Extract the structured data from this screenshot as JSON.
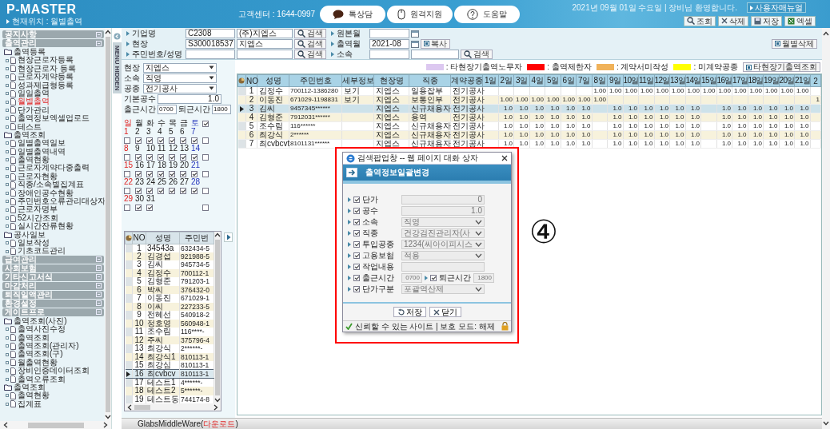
{
  "header": {
    "logo": "P-MASTER",
    "location": "현재위치 : 월별출역",
    "support": "고객센터 : 1644-0997",
    "buttons": [
      "톡상담",
      "원격지원",
      "도움말"
    ],
    "greeting": "2021년 09월 01일 수요일 | 장비님 환영합니다.",
    "manual_button": "사용자매뉴얼",
    "toolbar": [
      "조회",
      "삭제",
      "저장",
      "엑셀"
    ]
  },
  "sidebar": {
    "sections": [
      {
        "title": "공지사항"
      },
      {
        "title": "출역관리",
        "folders": [
          {
            "label": "출역등록",
            "items": [
              {
                "label": "현장근로자등록",
                "selected": false
              },
              {
                "label": "현장근로자 등록",
                "selected": false
              },
              {
                "label": "근로자계약등록",
                "selected": false
              },
              {
                "label": "성과제급형등록",
                "selected": false
              },
              {
                "label": "일일출역",
                "selected": false
              },
              {
                "label": "월별출역",
                "selected": true
              },
              {
                "label": "단가관리",
                "selected": false
              },
              {
                "label": "출역정보엑셀업로드",
                "selected": false
              },
              {
                "label": "테스트",
                "selected": false
              }
            ]
          },
          {
            "label": "출역조회",
            "items": [
              {
                "label": "일별출역일보",
                "selected": false
              },
              {
                "label": "일별출역내역",
                "selected": false
              },
              {
                "label": "출역현황",
                "selected": false
              },
              {
                "label": "근로자계약다중출력",
                "selected": false
              },
              {
                "label": "근로자현황",
                "selected": false
              },
              {
                "label": "직종/소속별집계표",
                "selected": false
              },
              {
                "label": "장애인공수현황",
                "selected": false
              },
              {
                "label": "주민번호오류관리대상자",
                "selected": false
              },
              {
                "label": "근로자명부",
                "selected": false
              },
              {
                "label": "52시간조회",
                "selected": false
              },
              {
                "label": "실시간잔류현황",
                "selected": false
              }
            ]
          },
          {
            "label": "공사일보",
            "items": [
              {
                "label": "일보작성",
                "selected": false
              },
              {
                "label": "기초코드관리",
                "selected": false
              }
            ]
          }
        ]
      },
      {
        "title": "급여관리"
      },
      {
        "title": "사회보험"
      },
      {
        "title": "기타신고서식"
      },
      {
        "title": "마감처리"
      },
      {
        "title": "퇴직일액관리"
      },
      {
        "title": "환경설정"
      },
      {
        "title": "게이트프로",
        "folders": [
          {
            "label": "출역조회(사진)",
            "items": [
              {
                "label": "출역사진수정",
                "selected": false
              },
              {
                "label": "출역조회",
                "selected": false
              },
              {
                "label": "출역조회(관리자)",
                "selected": false
              },
              {
                "label": "출역조회(구)",
                "selected": false
              },
              {
                "label": "월출역현황",
                "selected": false
              },
              {
                "label": "장비인증데이터조회",
                "selected": false
              },
              {
                "label": "출역오류조회",
                "selected": false
              }
            ]
          },
          {
            "label": "출역조회",
            "items": [
              {
                "label": "출역현황",
                "selected": false
              },
              {
                "label": "집계표",
                "selected": false
              }
            ]
          }
        ]
      }
    ]
  },
  "menu_tab": "MENU HIDDEN",
  "search_form": {
    "left": [
      {
        "label": "기업명",
        "code": "C2308",
        "name": "(주)지엡스",
        "button": "검색"
      },
      {
        "label": "현장",
        "code": "S300018537",
        "name": "지엡스",
        "button": "검색"
      },
      {
        "label": "주민번호/성명",
        "button": "검색"
      }
    ],
    "right": [
      {
        "label": "원본월",
        "kind": "month"
      },
      {
        "label": "출역월",
        "kind": "month",
        "value": "2021-08",
        "button": "복사"
      },
      {
        "label": "소속",
        "kind": "search",
        "button": "검색"
      }
    ],
    "delete_button": "월별삭제"
  },
  "legend": [
    {
      "label": ": 타현장기출역노무자",
      "color": "#dcc8f0"
    },
    {
      "label": ": 출역제한자",
      "color": "#ff0000"
    },
    {
      "label": ": 계약서미작성",
      "color": "#f0b25a"
    },
    {
      "label": ": 미계약공종",
      "color": "#ffff00"
    }
  ],
  "legend_button": "타현장기출역조회",
  "filters": {
    "selects": [
      {
        "label": "현장",
        "value": "지엡스"
      },
      {
        "label": "소속",
        "value": "직영"
      },
      {
        "label": "공종",
        "value": "전기공사"
      }
    ],
    "base_label": "기본공수",
    "base_value": "1.0",
    "start_label": "출근시간",
    "start_value": "0700",
    "end_label": "퇴근시간",
    "end_value": "1800"
  },
  "calendar": {
    "weekdays": [
      "일",
      "월",
      "화",
      "수",
      "목",
      "금",
      "토"
    ],
    "all_checked": true,
    "weeks": [
      {
        "row_checked": false,
        "days": [
          {
            "day": "1",
            "checked": false
          },
          {
            "day": "2",
            "checked": true
          },
          {
            "day": "3",
            "checked": true
          },
          {
            "day": "4",
            "checked": true
          },
          {
            "day": "5",
            "checked": true
          },
          {
            "day": "6",
            "checked": true
          },
          {
            "day": "7",
            "checked": true
          }
        ]
      },
      {
        "row_checked": false,
        "days": [
          {
            "day": "8",
            "checked": false
          },
          {
            "day": "9",
            "checked": true
          },
          {
            "day": "10",
            "checked": true
          },
          {
            "day": "11",
            "checked": true
          },
          {
            "day": "12",
            "checked": true
          },
          {
            "day": "13",
            "checked": true
          },
          {
            "day": "14",
            "checked": true
          }
        ]
      },
      {
        "row_checked": false,
        "days": [
          {
            "day": "15",
            "checked": false
          },
          {
            "day": "16",
            "checked": true
          },
          {
            "day": "17",
            "checked": true
          },
          {
            "day": "18",
            "checked": true
          },
          {
            "day": "19",
            "checked": true
          },
          {
            "day": "20",
            "checked": true
          },
          {
            "day": "21",
            "checked": true
          }
        ]
      },
      {
        "row_checked": false,
        "days": [
          {
            "day": "22",
            "checked": false
          },
          {
            "day": "23",
            "checked": true
          },
          {
            "day": "24",
            "checked": true
          },
          {
            "day": "25",
            "checked": true
          },
          {
            "day": "26",
            "checked": true
          },
          {
            "day": "27",
            "checked": true
          },
          {
            "day": "28",
            "checked": true
          }
        ]
      },
      {
        "row_checked": false,
        "days": [
          {
            "day": "29",
            "checked": false
          },
          {
            "day": "30",
            "checked": true
          },
          {
            "day": "31",
            "checked": true
          }
        ]
      }
    ]
  },
  "worker_list": {
    "columns": [
      "NO",
      "성명",
      "주민번"
    ],
    "rows": [
      {
        "no": "1",
        "name": "34543a",
        "id": "632434-5",
        "selected": false
      },
      {
        "no": "2",
        "name": "김경섭",
        "id": "921988-5",
        "selected": false
      },
      {
        "no": "3",
        "name": "김씨",
        "id": "945734-5",
        "selected": false
      },
      {
        "no": "4",
        "name": "김정수",
        "id": "700112-1",
        "selected": false
      },
      {
        "no": "5",
        "name": "김형준",
        "id": "791203-1",
        "selected": false
      },
      {
        "no": "6",
        "name": "박씨",
        "id": "376432-0",
        "selected": false
      },
      {
        "no": "7",
        "name": "이동진",
        "id": "671029-1",
        "selected": false
      },
      {
        "no": "8",
        "name": "이씨",
        "id": "227233-5",
        "selected": false
      },
      {
        "no": "9",
        "name": "전혜선",
        "id": "540918-2",
        "selected": false
      },
      {
        "no": "10",
        "name": "정호영",
        "id": "560948-1",
        "selected": false
      },
      {
        "no": "11",
        "name": "조수림",
        "id": "116****-",
        "selected": false
      },
      {
        "no": "12",
        "name": "주씨",
        "id": "375796-4",
        "selected": false
      },
      {
        "no": "13",
        "name": "최강식",
        "id": "2******-",
        "selected": false
      },
      {
        "no": "14",
        "name": "최강식1",
        "id": "810113-1",
        "selected": false
      },
      {
        "no": "15",
        "name": "최강심",
        "id": "810113-1",
        "selected": false
      },
      {
        "no": "16",
        "name": "최cvbcv",
        "id": "810113-1",
        "selected": true
      },
      {
        "no": "17",
        "name": "테스트1",
        "id": "4******-",
        "selected": false
      },
      {
        "no": "18",
        "name": "테스트2",
        "id": "5******-",
        "selected": false
      },
      {
        "no": "19",
        "name": "테스트동",
        "id": "744174-8",
        "selected": false
      }
    ]
  },
  "grid": {
    "columns": [
      "NO",
      "성명",
      "주민번호",
      "세부정보",
      "현장명",
      "직종",
      "계약공종",
      "1일",
      "2일",
      "3일",
      "4일",
      "5일",
      "6일",
      "7일",
      "8일",
      "9일",
      "10일",
      "11일",
      "12일",
      "13일",
      "14일",
      "15일",
      "16일",
      "17일",
      "18일",
      "19일",
      "20일",
      "21일",
      "2"
    ],
    "rows": [
      {
        "selected": false,
        "cells": [
          "1",
          "김정수",
          "700112-1386280",
          "보기",
          "지엡스",
          "일용잡부",
          "전기공사",
          null,
          null,
          null,
          null,
          null,
          null,
          null,
          "1.00",
          "1.00",
          "1.00",
          "1.00",
          "1.00",
          "1.00",
          "1.00",
          "1.00",
          "1.00",
          "1.00",
          "1.00",
          "1.00",
          "1.00",
          "1.00",
          null
        ]
      },
      {
        "selected": false,
        "cells": [
          "2",
          "이동진",
          "671029-1198831",
          "보기",
          "지엡스",
          "보통인부",
          "전기공사",
          null,
          "1.00",
          "1.00",
          "1.00",
          "1.00",
          "1.00",
          "1.00",
          "1.00",
          null,
          null,
          null,
          null,
          null,
          null,
          null,
          null,
          null,
          null,
          null,
          null,
          null,
          "1"
        ]
      },
      {
        "selected": true,
        "cells": [
          "3",
          "김씨",
          "9457345******",
          null,
          "지엡스",
          "신규채용자",
          "전기공사",
          null,
          "1.0",
          "1.0",
          "1.0",
          "1.0",
          "1.0",
          "1.0",
          null,
          "1.0",
          "1.0",
          "1.0",
          "1.0",
          "1.0",
          "1.0",
          null,
          "1.0",
          "1.0",
          "1.0",
          "1.0",
          "1.0",
          "1.0",
          null
        ]
      },
      {
        "selected": false,
        "cells": [
          "4",
          "김형준",
          "7912031******",
          null,
          "지엡스",
          "용역",
          "전기공사",
          null,
          "1.0",
          "1.0",
          "1.0",
          "1.0",
          "1.0",
          "1.0",
          null,
          "1.0",
          "1.0",
          "1.0",
          "1.0",
          "1.0",
          "1.0",
          null,
          "1.0",
          "1.0",
          "1.0",
          "1.0",
          "1.0",
          "1.0",
          null
        ]
      },
      {
        "selected": false,
        "cells": [
          "5",
          "조수림",
          "116******",
          null,
          "지엡스",
          "신규채용자",
          "전기공사",
          null,
          "1.0",
          "1.0",
          "1.0",
          "1.0",
          "1.0",
          "1.0",
          null,
          "1.0",
          "1.0",
          "1.0",
          "1.0",
          "1.0",
          "1.0",
          null,
          "1.0",
          "1.0",
          "1.0",
          "1.0",
          "1.0",
          "1.0",
          null
        ]
      },
      {
        "selected": false,
        "cells": [
          "6",
          "최강식",
          "2******",
          null,
          "지엡스",
          "신규채용자",
          "전기공사",
          null,
          "1.0",
          "1.0",
          "1.0",
          "1.0",
          "1.0",
          "1.0",
          null,
          "1.0",
          "1.0",
          "1.0",
          "1.0",
          "1.0",
          "1.0",
          null,
          "1.0",
          "1.0",
          "1.0",
          "1.0",
          "1.0",
          "1.0",
          null
        ]
      },
      {
        "selected": false,
        "cells": [
          "7",
          "최cvbcvt",
          "8101131******",
          null,
          "지엡스",
          "신규채용자",
          "전기공사",
          null,
          "1.0",
          "1.0",
          "1.0",
          "1.0",
          "1.0",
          "1.0",
          null,
          "1.0",
          "1.0",
          "1.0",
          "1.0",
          "1.0",
          "1.0",
          null,
          "1.0",
          "1.0",
          "1.0",
          "1.0",
          "1.0",
          "1.0",
          null
        ]
      }
    ]
  },
  "footer": {
    "label": "GlabsMiddleWare(",
    "link": "다운로드",
    "suffix": ")"
  },
  "dialog": {
    "title": "검색팝업창 -- 웹 페이지 대화 상자",
    "heading": "출역정보일괄변경",
    "fields": [
      {
        "kind": "text",
        "label": "단가",
        "checked": true,
        "disabled": true,
        "value": "0"
      },
      {
        "kind": "text",
        "label": "공수",
        "checked": true,
        "disabled": true,
        "value": "1.0"
      },
      {
        "kind": "select",
        "label": "소속",
        "checked": true,
        "disabled": true,
        "value": "직영"
      },
      {
        "kind": "select",
        "label": "직종",
        "checked": true,
        "disabled": true,
        "value": "건강검진관리자(사"
      },
      {
        "kind": "select",
        "label": "투입공종",
        "checked": true,
        "disabled": true,
        "value": "1234(씨아이피시스"
      },
      {
        "kind": "select",
        "label": "고용보험",
        "checked": true,
        "disabled": true,
        "value": "적용"
      },
      {
        "kind": "text",
        "label": "작업내용",
        "checked": true,
        "disabled": true
      },
      {
        "kind": "time",
        "label": "출근시간",
        "checked": true,
        "disabled": true,
        "value": "0700",
        "end_label": "퇴근시간",
        "end_checked": true,
        "end_value": "1800"
      },
      {
        "kind": "select",
        "label": "단가구분",
        "checked": true,
        "disabled": true,
        "value": "포괄역산제"
      }
    ],
    "buttons": [
      "저장",
      "닫기"
    ],
    "status": "신뢰할 수 있는 사이트 | 보호 모드: 해제"
  },
  "annotation": {
    "step": "④"
  }
}
